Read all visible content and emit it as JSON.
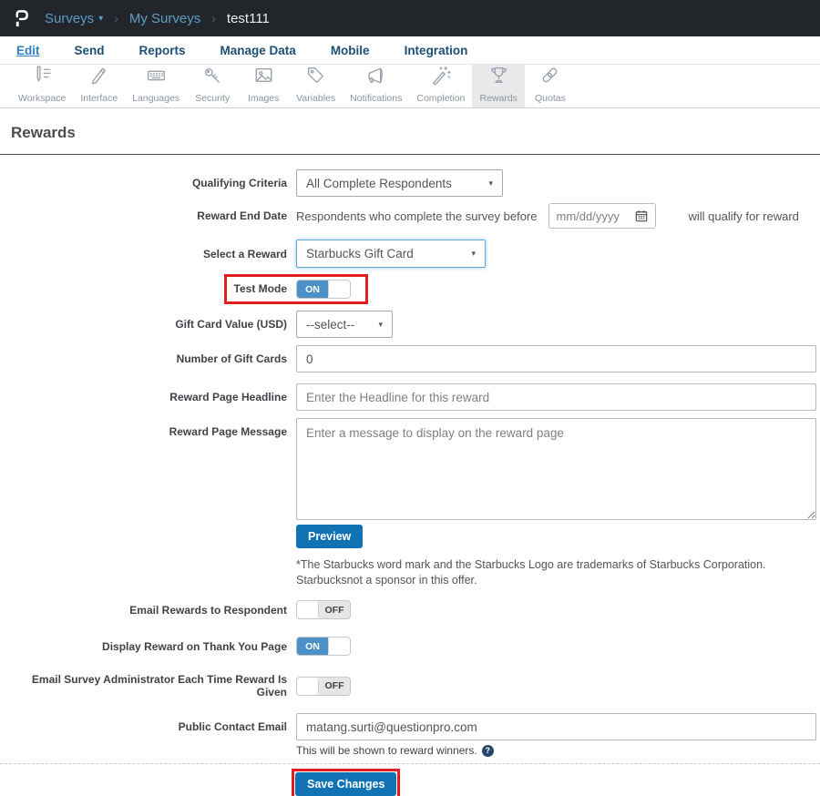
{
  "colors": {
    "header_bg": "#22262b",
    "accent_blue": "#1173b4",
    "toggle_blue": "#4b90c7",
    "annotation_red": "#e11d1d",
    "active_tab_blue": "#2e80c2",
    "nav_navy": "#1d4e74",
    "breadcrumb_blue": "#5e9cc6"
  },
  "glyphs": {
    "caret": "▾",
    "separator": "›",
    "select_caret": "▼",
    "help": "?"
  },
  "header": {
    "breadcrumb": [
      {
        "label": "Surveys"
      },
      {
        "label": "My Surveys"
      },
      {
        "label": "test111"
      }
    ]
  },
  "tabs": [
    {
      "label": "Edit",
      "active": true
    },
    {
      "label": "Send"
    },
    {
      "label": "Reports"
    },
    {
      "label": "Manage Data"
    },
    {
      "label": "Mobile"
    },
    {
      "label": "Integration"
    }
  ],
  "toolbar": {
    "items": [
      {
        "label": "Workspace",
        "icon": "workspace-icon"
      },
      {
        "label": "Interface",
        "icon": "interface-icon"
      },
      {
        "label": "Languages",
        "icon": "languages-icon"
      },
      {
        "label": "Security",
        "icon": "security-icon"
      },
      {
        "label": "Images",
        "icon": "images-icon"
      },
      {
        "label": "Variables",
        "icon": "variables-icon"
      },
      {
        "label": "Notifications",
        "icon": "notifications-icon"
      },
      {
        "label": "Completion",
        "icon": "completion-icon"
      },
      {
        "label": "Rewards",
        "icon": "rewards-icon",
        "active": true
      },
      {
        "label": "Quotas",
        "icon": "quotas-icon"
      }
    ]
  },
  "page": {
    "title": "Rewards"
  },
  "form": {
    "qualifying_criteria": {
      "label": "Qualifying Criteria",
      "value": "All Complete Respondents"
    },
    "reward_end_date": {
      "label": "Reward End Date",
      "text_before": "Respondents who complete the survey before",
      "placeholder": "mm/dd/yyyy",
      "text_after": "will qualify for reward"
    },
    "select_reward": {
      "label": "Select a Reward",
      "value": "Starbucks Gift Card"
    },
    "test_mode": {
      "label": "Test Mode",
      "state": "ON"
    },
    "gift_card_value": {
      "label": "Gift Card Value (USD)",
      "value": "--select--"
    },
    "num_gift_cards": {
      "label": "Number of Gift Cards",
      "value": "0"
    },
    "headline": {
      "label": "Reward Page Headline",
      "placeholder": "Enter the Headline for this reward"
    },
    "message": {
      "label": "Reward Page Message",
      "placeholder": "Enter a message to display on the reward page"
    },
    "preview_label": "Preview",
    "disclaimer": "*The Starbucks word mark and the Starbucks Logo are trademarks of Starbucks Corporation. Starbucksnot a sponsor in this offer.",
    "email_rewards": {
      "label": "Email Rewards to Respondent",
      "state": "OFF"
    },
    "display_reward": {
      "label": "Display Reward on Thank You Page",
      "state": "ON"
    },
    "email_admin": {
      "label": "Email Survey Administrator Each Time Reward Is Given",
      "state": "OFF"
    },
    "contact_email": {
      "label": "Public Contact Email",
      "value": "matang.surti@questionpro.com",
      "help_text": "This will be shown to reward winners."
    },
    "save_label": "Save Changes"
  }
}
